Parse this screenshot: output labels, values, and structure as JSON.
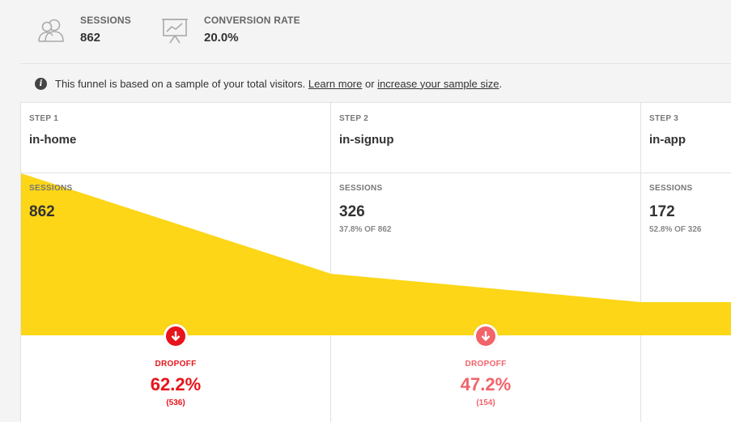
{
  "metrics": {
    "sessions": {
      "label": "SESSIONS",
      "value": "862"
    },
    "conversion": {
      "label": "CONVERSION RATE",
      "value": "20.0%"
    }
  },
  "notice": {
    "text_before": "This funnel is based on a sample of your total visitors.",
    "learn_more": "Learn more",
    "or": "or",
    "increase": "increase your sample size",
    "end": "."
  },
  "funnel": {
    "fill_color": "#fcd617",
    "sessions_label": "SESSIONS",
    "dropoff_label": "DROPOFF",
    "steps": [
      {
        "step_label": "STEP 1",
        "name": "in-home",
        "sessions": "862",
        "pct_text": "",
        "sessions_value": 862
      },
      {
        "step_label": "STEP 2",
        "name": "in-signup",
        "sessions": "326",
        "pct_text": "37.8% OF 862",
        "sessions_value": 326
      },
      {
        "step_label": "STEP 3",
        "name": "in-app",
        "sessions": "172",
        "pct_text": "52.8% OF 326",
        "sessions_value": 172
      }
    ],
    "dropoffs": [
      {
        "label": "DROPOFF",
        "pct": "62.2%",
        "count": "(536)",
        "color": "#e8141b"
      },
      {
        "label": "DROPOFF",
        "pct": "47.2%",
        "count": "(154)",
        "color": "#f2636a"
      }
    ]
  }
}
